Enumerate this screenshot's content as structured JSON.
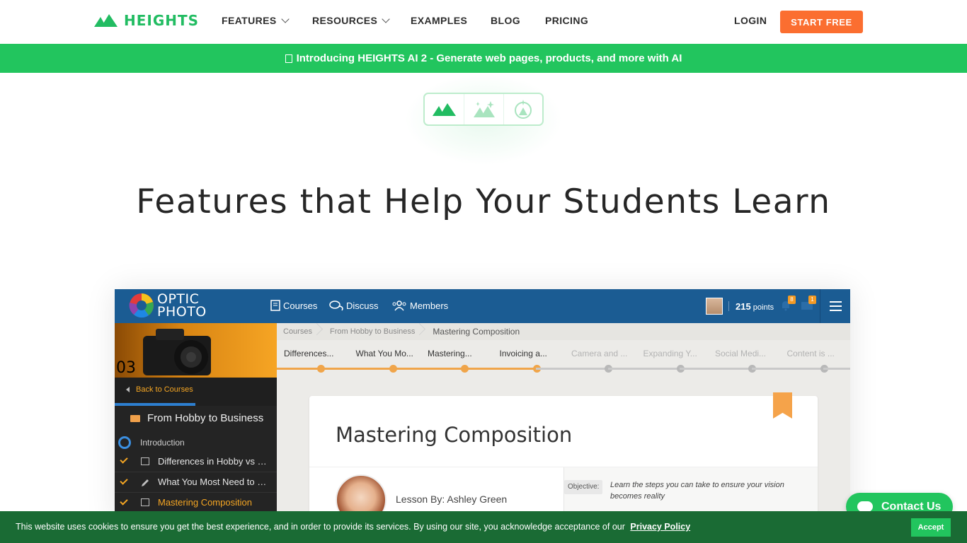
{
  "brand": {
    "name": "HEIGHTS",
    "color": "#22bc62"
  },
  "nav": {
    "features": "FEATURES",
    "resources": "RESOURCES",
    "examples": "EXAMPLES",
    "blog": "BLOG",
    "pricing": "PRICING",
    "login": "LOGIN",
    "start_free": "START FREE",
    "accent": "#fb6e30"
  },
  "announcement": {
    "text": "Introducing HEIGHTS AI 2 - Generate web pages, products, and more with AI",
    "icon": "sparkle-icon"
  },
  "selector": {
    "items": [
      "mountain-icon",
      "sparkle-mountain-icon",
      "mountain-badge-icon"
    ]
  },
  "hero": {
    "title": "Features that Help Your Students Learn"
  },
  "app": {
    "logo_line1": "OPTIC",
    "logo_line2": "PHOTO",
    "nav": [
      "Courses",
      "Discuss",
      "Members"
    ],
    "points_value": "215",
    "points_label": "points",
    "notif_count": "8",
    "message_count": "1",
    "back_link": "Back to Courses",
    "course_title": "From Hobby to Business",
    "section": "Introduction",
    "lessons": [
      "Differences in Hobby vs P...",
      "What You Most Need to Wor...",
      "Mastering Composition"
    ],
    "breadcrumbs": [
      "Courses",
      "From Hobby to Business",
      "Mastering Composition"
    ],
    "steps": [
      "Differences...",
      "What You Mo...",
      "Mastering...",
      "Invoicing a...",
      "Camera and ...",
      "Expanding Y...",
      "Social Medi...",
      "Content is ..."
    ],
    "completed_steps": 4,
    "card_title": "Mastering Composition",
    "lesson_by": "Lesson By: Ashley Green",
    "objective_label": "Objective:",
    "objective_text": "Learn the steps you can take to ensure your vision becomes reality"
  },
  "chat": {
    "label": "Contact Us"
  },
  "cookie": {
    "text": "This website uses cookies to ensure you get the best experience, and in order to provide its services. By using our site, you acknowledge acceptance of our",
    "link": "Privacy Policy",
    "accept": "Accept"
  }
}
